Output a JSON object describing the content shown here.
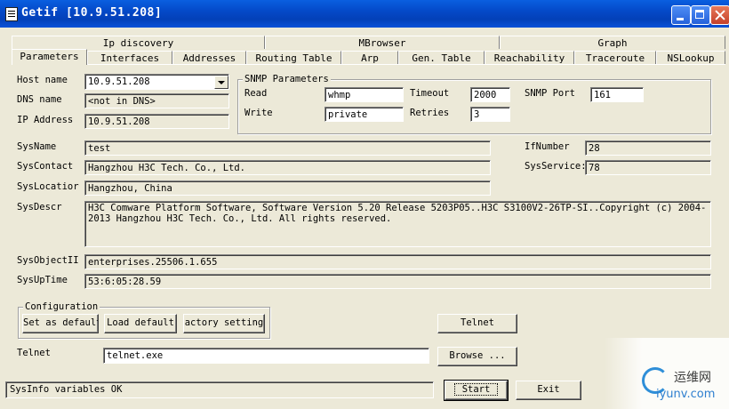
{
  "window": {
    "title": "Getif [10.9.51.208]"
  },
  "tabs_row1": [
    "Ip discovery",
    "MBrowser",
    "Graph"
  ],
  "tabs_row2": [
    "Parameters",
    "Interfaces",
    "Addresses",
    "Routing Table",
    "Arp",
    "Gen. Table",
    "Reachability",
    "Traceroute",
    "NSLookup"
  ],
  "host": {
    "label": "Host name",
    "value": "10.9.51.208"
  },
  "dns": {
    "label": "DNS name",
    "value": "<not in DNS>"
  },
  "ip": {
    "label": "IP Address",
    "value": "10.9.51.208"
  },
  "snmp": {
    "title": "SNMP Parameters",
    "read_label": "Read",
    "read_value": "whmp",
    "write_label": "Write",
    "write_value": "private",
    "timeout_label": "Timeout",
    "timeout_value": "2000",
    "retries_label": "Retries",
    "retries_value": "3",
    "port_label": "SNMP Port",
    "port_value": "161"
  },
  "sys": {
    "name_label": "SysName",
    "name_value": "test",
    "contact_label": "SysContact",
    "contact_value": "Hangzhou H3C Tech. Co., Ltd.",
    "location_label": "SysLocatior",
    "location_value": "Hangzhou, China",
    "descr_label": "SysDescr",
    "descr_value": "H3C Comware Platform Software, Software Version 5.20 Release 5203P05..H3C S3100V2-26TP-SI..Copyright (c) 2004-2013 Hangzhou H3C Tech. Co., Ltd. All rights reserved.",
    "objectid_label": "SysObjectII",
    "objectid_value": "enterprises.25506.1.655",
    "uptime_label": "SysUpTime",
    "uptime_value": "53:6:05:28.59",
    "ifnumber_label": "IfNumber",
    "ifnumber_value": "28",
    "services_label": "SysService:",
    "services_value": "78"
  },
  "config": {
    "title": "Configuration",
    "set_default": "Set as default",
    "load_default": "Load default",
    "factory": "actory setting"
  },
  "telnet": {
    "button": "Telnet",
    "label": "Telnet",
    "path": "telnet.exe",
    "browse": "Browse ..."
  },
  "status_text": "SysInfo variables OK",
  "start": "Start",
  "exit": "Exit",
  "watermark": {
    "line1": "运维网",
    "line2": "iyunv.com"
  }
}
